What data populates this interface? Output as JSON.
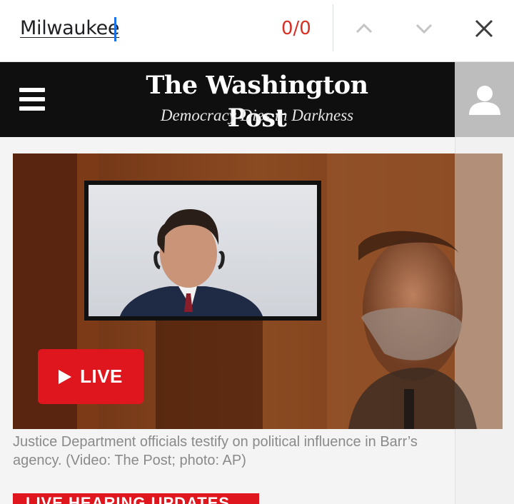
{
  "find_bar": {
    "query": "Milwaukee",
    "match_count": "0/0",
    "prev_icon": "chevron-up-icon",
    "next_icon": "chevron-down-icon",
    "close_icon": "close-icon",
    "count_color": "#d93025",
    "cursor_color": "#1a73e8"
  },
  "header": {
    "menu_icon": "hamburger-menu-icon",
    "masthead": "The Washington Post",
    "tagline": "Democracy Dies in Darkness",
    "account_icon": "user-icon",
    "background": "#0f0f0f"
  },
  "video": {
    "live_label": "LIVE",
    "play_icon": "play-icon",
    "live_color": "#e0161f",
    "caption": "Justice Department officials testify on political influence in Barr’s agency. (Video: The Post; photo: AP)"
  },
  "banner": {
    "label": "LIVE HEARING UPDATES"
  }
}
